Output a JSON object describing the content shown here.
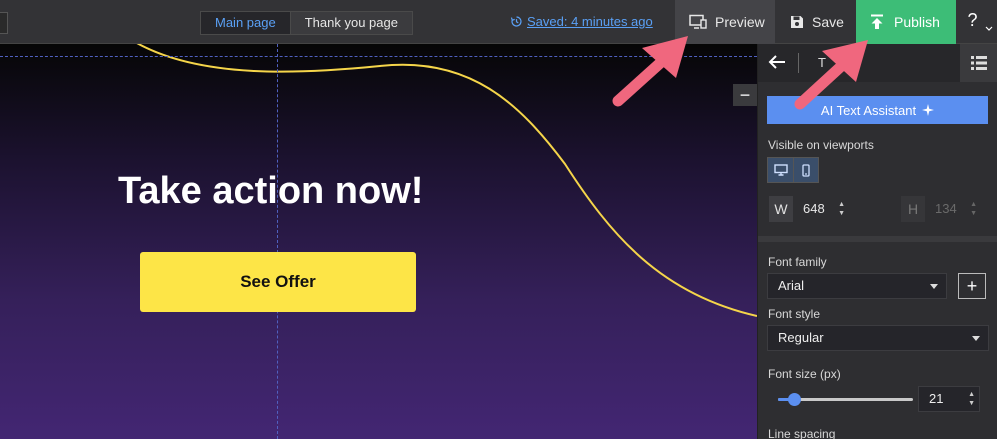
{
  "topbar": {
    "tabs": [
      {
        "label": "Main page",
        "active": true
      },
      {
        "label": "Thank you page",
        "active": false
      }
    ],
    "saved_text": "Saved: 4 minutes ago",
    "preview_label": "Preview",
    "save_label": "Save",
    "publish_label": "Publish",
    "help_label": "?"
  },
  "canvas": {
    "headline": "Take action now!",
    "cta_label": "See Offer",
    "minus_label": "−"
  },
  "panel": {
    "header_title": "T",
    "ai_button_label": "AI Text Assistant",
    "viewports_label": "Visible on viewports",
    "width_letter": "W",
    "width_value": "648",
    "height_letter": "H",
    "height_value": "134",
    "font_family_label": "Font family",
    "font_family_value": "Arial",
    "plus_label": "+",
    "font_style_label": "Font style",
    "font_style_value": "Regular",
    "font_size_label": "Font size (px)",
    "font_size_value": "21",
    "font_size_slider_fraction": 0.12,
    "line_spacing_label": "Line spacing"
  },
  "colors": {
    "accent_blue": "#5b8ff0",
    "publish_green": "#3dbd77",
    "cta_yellow": "#fde547",
    "curve_yellow": "#f5d54a",
    "arrow_pink": "#f0677e"
  },
  "icons": {
    "saved": "history-icon",
    "preview": "monitor-icon",
    "save": "floppy-icon",
    "publish": "upload-icon",
    "back": "arrow-left-icon",
    "list": "list-icon",
    "ai": "sparkle-icon",
    "desktop": "desktop-icon",
    "mobile": "mobile-icon"
  }
}
